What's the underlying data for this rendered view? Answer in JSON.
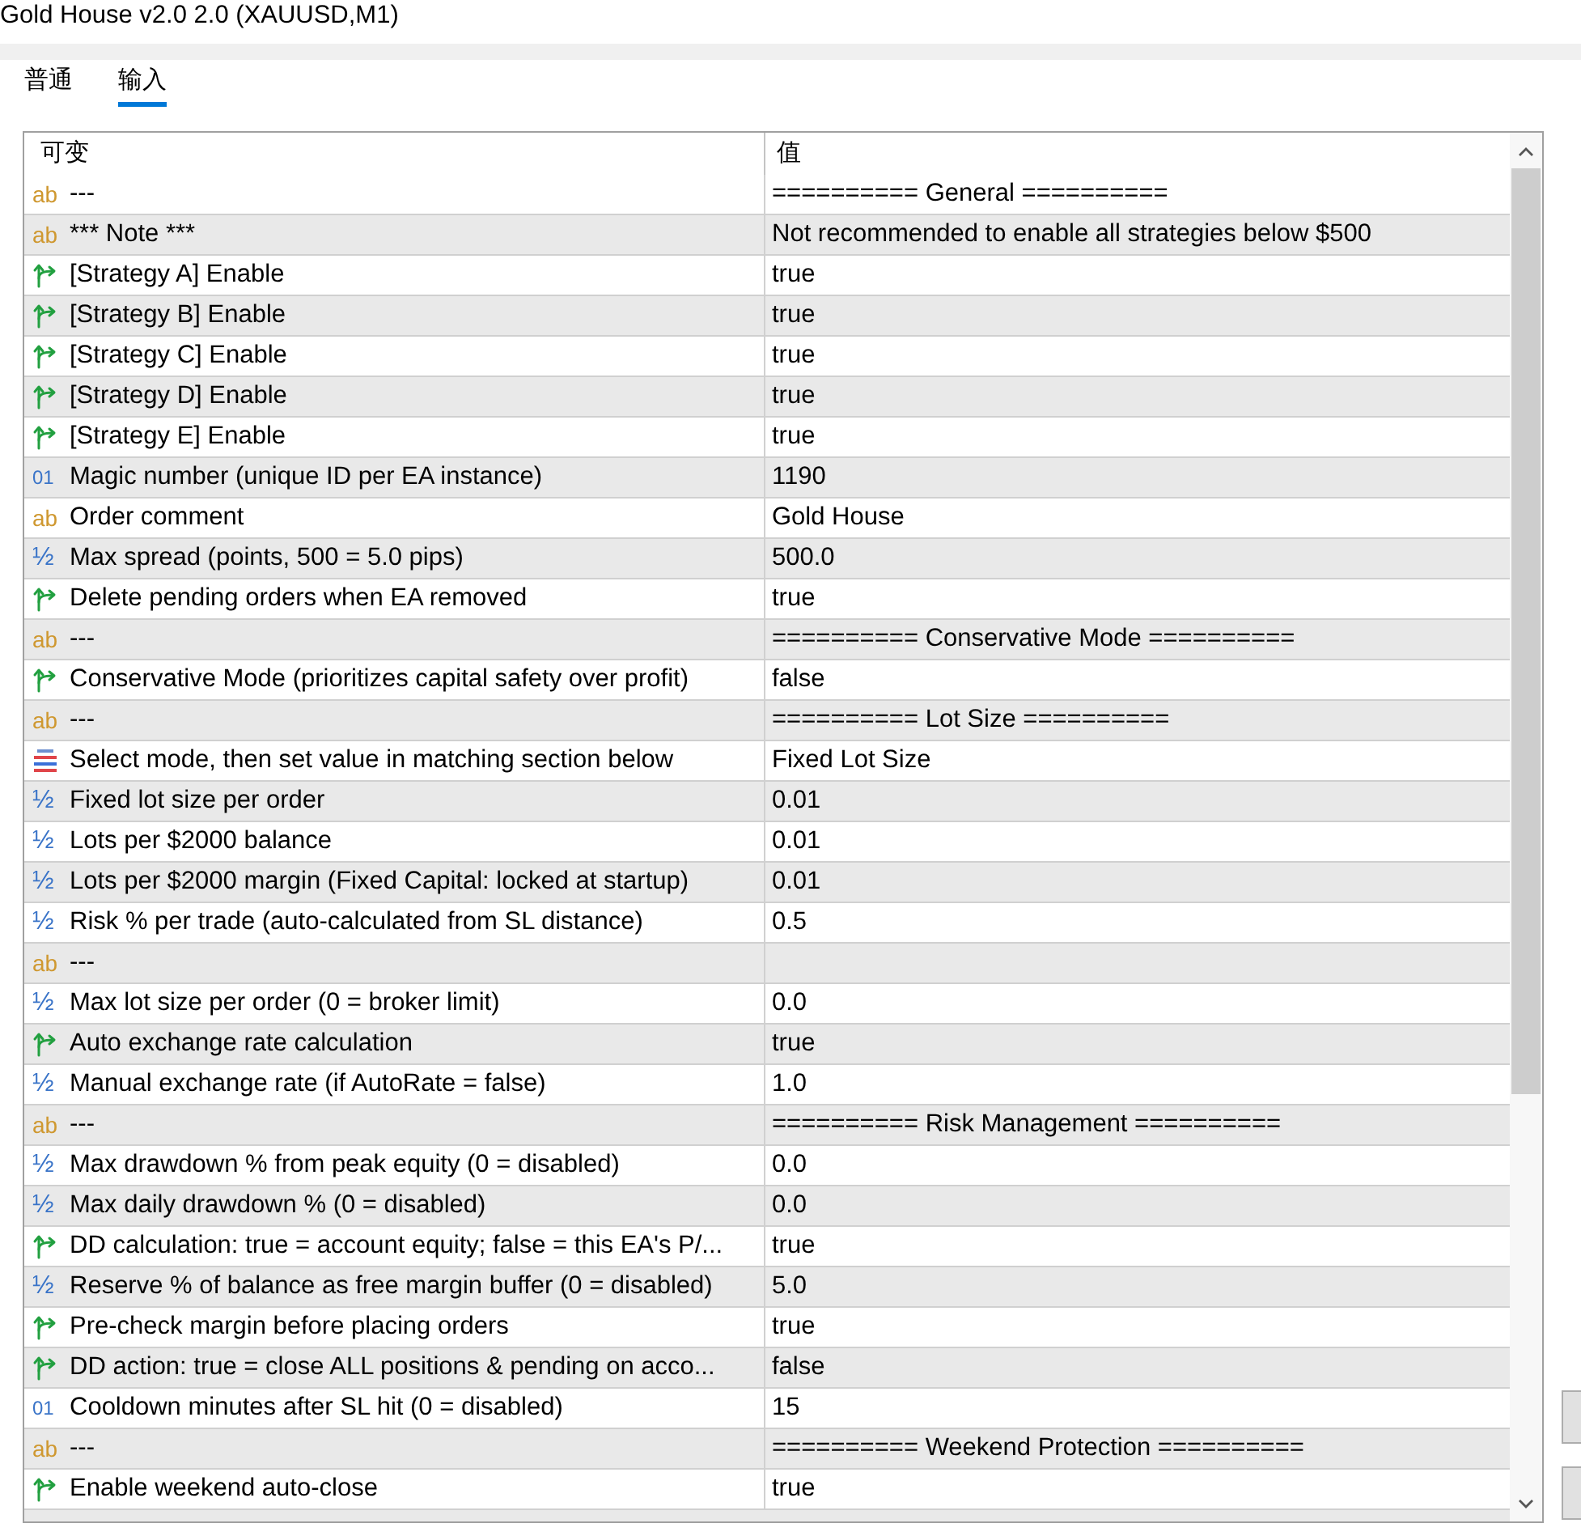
{
  "window": {
    "title": "Gold House v2.0 2.0 (XAUUSD,M1)"
  },
  "tabs": [
    {
      "label": "普通",
      "selected": false
    },
    {
      "label": "输入",
      "selected": true
    }
  ],
  "table": {
    "columns": [
      "可变",
      "值"
    ],
    "rows": [
      {
        "kind": "string",
        "glyph": "ab",
        "name": "---",
        "value": "========== General =========="
      },
      {
        "kind": "string",
        "glyph": "ab",
        "name": "*** Note ***",
        "value": "Not recommended to enable all strategies below $500"
      },
      {
        "kind": "bool",
        "name": "[Strategy A] Enable",
        "value": "true"
      },
      {
        "kind": "bool",
        "name": "[Strategy B] Enable",
        "value": "true"
      },
      {
        "kind": "bool",
        "name": "[Strategy C] Enable",
        "value": "true"
      },
      {
        "kind": "bool",
        "name": "[Strategy D] Enable",
        "value": "true"
      },
      {
        "kind": "bool",
        "name": "[Strategy E] Enable",
        "value": "true"
      },
      {
        "kind": "int",
        "glyph": "01",
        "name": "Magic number (unique ID per EA instance)",
        "value": "1190"
      },
      {
        "kind": "string",
        "glyph": "ab",
        "name": "Order comment",
        "value": "Gold House"
      },
      {
        "kind": "double",
        "glyph": "½",
        "name": "Max spread (points, 500 = 5.0 pips)",
        "value": "500.0"
      },
      {
        "kind": "bool",
        "name": "Delete pending orders when EA removed",
        "value": "true"
      },
      {
        "kind": "string",
        "glyph": "ab",
        "name": "---",
        "value": "========== Conservative Mode =========="
      },
      {
        "kind": "bool",
        "name": "Conservative Mode (prioritizes capital safety over profit)",
        "value": "false"
      },
      {
        "kind": "string",
        "glyph": "ab",
        "name": "---",
        "value": "========== Lot Size =========="
      },
      {
        "kind": "enum",
        "name": "Select mode, then set value in matching section below",
        "value": "Fixed Lot Size"
      },
      {
        "kind": "double",
        "glyph": "½",
        "name": "Fixed lot size per order",
        "value": "0.01"
      },
      {
        "kind": "double",
        "glyph": "½",
        "name": "Lots per $2000 balance",
        "value": "0.01"
      },
      {
        "kind": "double",
        "glyph": "½",
        "name": "Lots per $2000 margin (Fixed Capital: locked at startup)",
        "value": "0.01"
      },
      {
        "kind": "double",
        "glyph": "½",
        "name": "Risk % per trade (auto-calculated from SL distance)",
        "value": "0.5"
      },
      {
        "kind": "string",
        "glyph": "ab",
        "name": "---"
      },
      {
        "kind": "double",
        "glyph": "½",
        "name": "Max lot size per order (0 = broker limit)",
        "value": "0.0"
      },
      {
        "kind": "bool",
        "name": "Auto exchange rate calculation",
        "value": "true"
      },
      {
        "kind": "double",
        "glyph": "½",
        "name": "Manual exchange rate (if AutoRate = false)",
        "value": "1.0"
      },
      {
        "kind": "string",
        "glyph": "ab",
        "name": "---",
        "value": "========== Risk Management =========="
      },
      {
        "kind": "double",
        "glyph": "½",
        "name": "Max drawdown % from peak equity (0 = disabled)",
        "value": "0.0"
      },
      {
        "kind": "double",
        "glyph": "½",
        "name": "Max daily drawdown % (0 = disabled)",
        "value": "0.0"
      },
      {
        "kind": "bool",
        "name": "DD calculation: true = account equity; false = this EA's P/...",
        "value": "true"
      },
      {
        "kind": "double",
        "glyph": "½",
        "name": "Reserve % of balance as free margin buffer (0 = disabled)",
        "value": "5.0"
      },
      {
        "kind": "bool",
        "name": "Pre-check margin before placing orders",
        "value": "true"
      },
      {
        "kind": "bool",
        "name": "DD action: true = close ALL positions & pending on acco...",
        "value": "false"
      },
      {
        "kind": "int",
        "glyph": "01",
        "name": "Cooldown minutes after SL hit (0 = disabled)",
        "value": "15"
      },
      {
        "kind": "string",
        "glyph": "ab",
        "name": "---",
        "value": "========== Weekend Protection =========="
      },
      {
        "kind": "bool",
        "name": "Enable weekend auto-close",
        "value": "true"
      }
    ]
  }
}
